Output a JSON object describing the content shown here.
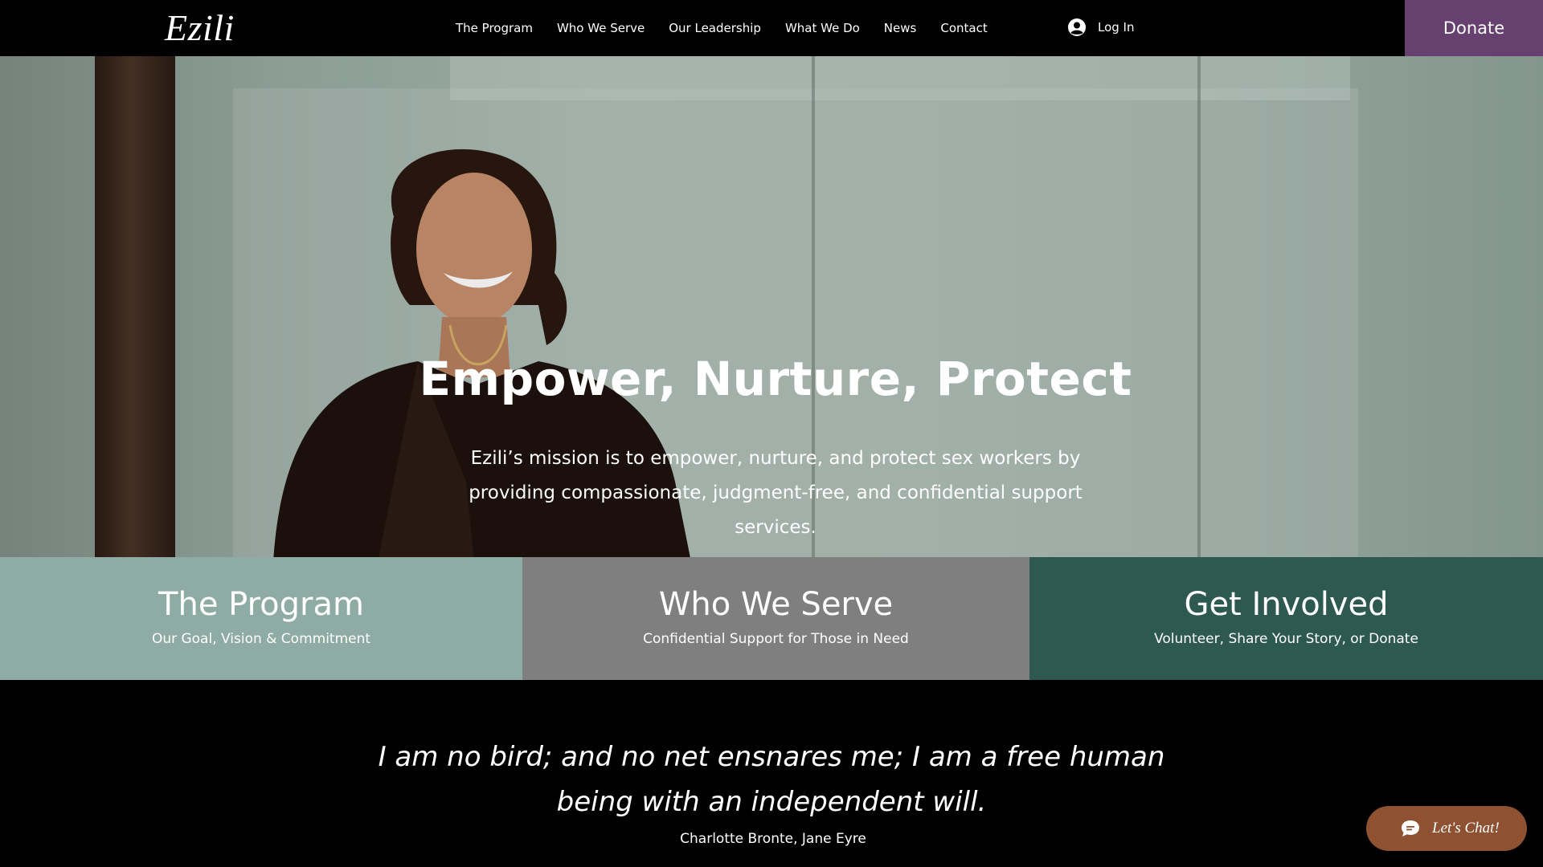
{
  "header": {
    "logo": "Ezili",
    "nav": [
      "The Program",
      "Who We Serve",
      "Our Leadership",
      "What We Do",
      "News",
      "Contact"
    ],
    "login_label": "Log In",
    "login_icon": "user-avatar-icon",
    "donate_label": "Donate"
  },
  "hero": {
    "title": "Empower, Nurture, Protect",
    "text": "Ezili’s mission is to empower, nurture, and protect sex workers by providing compassionate, judgment-free, and confidential support services."
  },
  "boxes": [
    {
      "title": "The Program",
      "subtitle": "Our Goal, Vision & Commitment",
      "color": "#8eaba4"
    },
    {
      "title": "Who We Serve",
      "subtitle": "Confidential Support for Those in Need",
      "color": "#7f7f7f"
    },
    {
      "title": "Get Involved",
      "subtitle": "Volunteer, Share Your Story, or Donate",
      "color": "#2e5950"
    }
  ],
  "quote": {
    "text": "I am no bird; and no net ensnares me; I am a free human being with an independent will.",
    "author": "Charlotte Bronte, Jane Eyre"
  },
  "chat": {
    "label": "Let's Chat!",
    "icon": "chat-bubble-icon"
  },
  "colors": {
    "donate": "#66406e",
    "chat": "#8e5132"
  }
}
